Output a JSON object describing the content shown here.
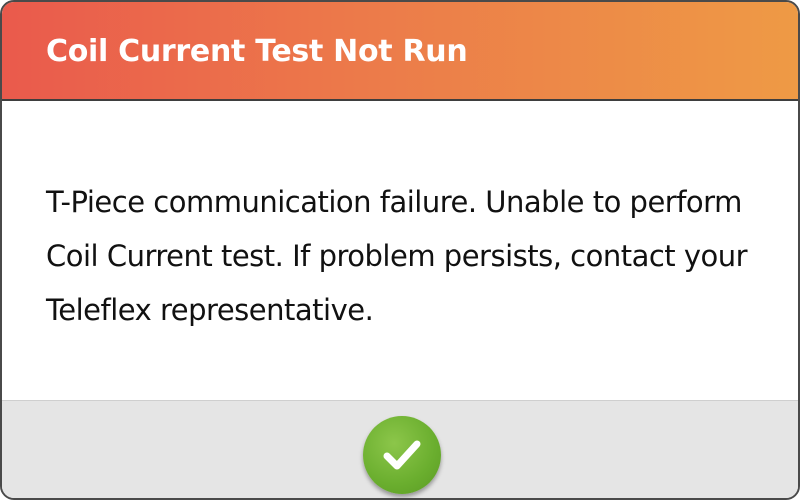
{
  "dialog": {
    "title": "Coil Current Test Not Run",
    "message": "T-Piece communication failure. Unable to perform Coil Current test. If problem persists, contact your Teleflex representative."
  },
  "footer": {
    "confirm_icon": "checkmark-icon"
  },
  "colors": {
    "header_gradient_start": "#ea5a4c",
    "header_gradient_end": "#ee9a45",
    "confirm_button": "#6aae2e",
    "footer_background": "#e5e5e5"
  }
}
